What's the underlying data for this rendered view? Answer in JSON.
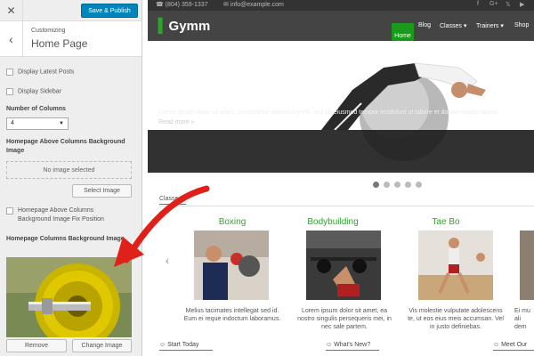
{
  "customizer": {
    "close_icon": "✕",
    "publish_label": "Save & Publish",
    "back_icon": "‹",
    "breadcrumb": "Customizing",
    "title": "Home Page",
    "display_latest_posts": "Display Latest Posts",
    "display_sidebar": "Display Sidebar",
    "number_of_columns_label": "Number of Columns",
    "columns_value": "4",
    "above_columns_bg_label": "Homepage Above Columns Background Image",
    "no_image_selected": "No image selected",
    "select_image": "Select Image",
    "fix_position_label": "Homepage Above Columns Background Image Fix Position",
    "columns_bg_label": "Homepage Columns Background Image",
    "remove": "Remove",
    "change_image": "Change Image",
    "accent": "#0085ba"
  },
  "site": {
    "phone": "(804) 359-1337",
    "email": "info@example.com",
    "social": [
      "f",
      "G+",
      "𝕏",
      "▶"
    ],
    "logo_text": "Gymm",
    "nav": [
      "Home",
      "Blog",
      "Classes ▾",
      "Trainers ▾",
      "Shop"
    ],
    "slide_title": "Lorem ipsum dolor",
    "slide_text": "Lorem ipsum dolor sit amet, consectetur adipisicing elit, sed do eiusmod tempor incididunt ut labore et dolore magna aliqua.",
    "read_more": "Read more »",
    "classes_heading": "Classes",
    "cards": [
      {
        "title": "Boxing",
        "text": "Melius tacimates intellegat sed id. Eum ei reque indoctum laboramus."
      },
      {
        "title": "Bodybuilding",
        "text": "Lorem ipsum dolor sit amet, ea nostro singulis persequeris mei, in nec sale partem."
      },
      {
        "title": "Tae Bo",
        "text": "Vis molestie vulputate adolescens te, ut eos eius meis accumsan. Vel in justo definiebas."
      },
      {
        "title": "",
        "text": "Ei mu ali dem"
      }
    ],
    "bottom": [
      "☺ Start Today",
      "☺ What's New?",
      "☺ Meet Our"
    ],
    "accent": "#2aa52a"
  }
}
